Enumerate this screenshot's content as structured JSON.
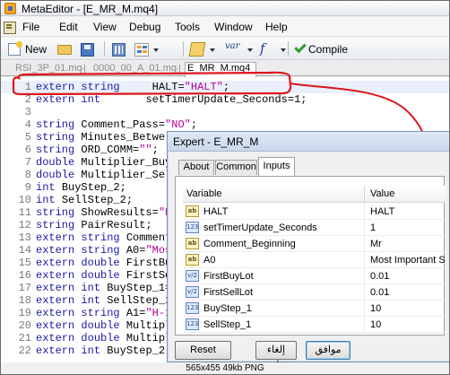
{
  "window": {
    "title": "MetaEditor - [E_MR_M.mq4]"
  },
  "menu": [
    "File",
    "Edit",
    "View",
    "Debug",
    "Tools",
    "Window",
    "Help"
  ],
  "toolbar": {
    "new_label": "New",
    "var_label": "var",
    "func_label": "f",
    "compile_label": "Compile"
  },
  "editor_tabs": [
    {
      "label": "RSI_3P_01.mq4",
      "active": false
    },
    {
      "label": "0000_00_A_01.mq4",
      "active": false
    },
    {
      "label": "E_MR_M.mq4",
      "active": true
    }
  ],
  "code_lines": [
    {
      "n": "1",
      "code": "extern string     HALT=\"HALT\";"
    },
    {
      "n": "2",
      "code": "extern int       setTimerUpdate_Seconds=1;"
    },
    {
      "n": "3",
      "code": ""
    },
    {
      "n": "4",
      "code": "string Comment_Pass=\"NO\";"
    },
    {
      "n": "5",
      "code": "string Minutes_Betwe"
    },
    {
      "n": "6",
      "code": "string ORD_COMM=\"\";"
    },
    {
      "n": "7",
      "code": "double Multiplier_Buy"
    },
    {
      "n": "8",
      "code": "double Multiplier_Sel"
    },
    {
      "n": "9",
      "code": "int BuyStep_2;"
    },
    {
      "n": "10",
      "code": "int SellStep_2;"
    },
    {
      "n": "11",
      "code": "string ShowResults=\"N"
    },
    {
      "n": "12",
      "code": "string PairResult;"
    },
    {
      "n": "13",
      "code": "extern string Comment"
    },
    {
      "n": "14",
      "code": "extern string A0=\"Mos"
    },
    {
      "n": "15",
      "code": "extern double FirstBu"
    },
    {
      "n": "16",
      "code": "extern double FirstSe"
    },
    {
      "n": "17",
      "code": "extern int BuyStep_1="
    },
    {
      "n": "18",
      "code": "extern int SellStep_1"
    },
    {
      "n": "19",
      "code": "extern string A1=\"H-1"
    },
    {
      "n": "20",
      "code": "extern double Multipl"
    },
    {
      "n": "21",
      "code": "extern double Multipl"
    },
    {
      "n": "22",
      "code": "extern int BuyStep_2"
    }
  ],
  "dialog": {
    "title": "Expert - E_MR_M",
    "tabs": [
      "About",
      "Common",
      "Inputs"
    ],
    "active_tab": "Inputs",
    "columns": [
      "Variable",
      "Value"
    ],
    "inputs": [
      {
        "type": "ab",
        "name": "HALT",
        "value": "HALT"
      },
      {
        "type": "123",
        "name": "setTimerUpdate_Seconds",
        "value": "1"
      },
      {
        "type": "ab",
        "name": "Comment_Beginning",
        "value": "Mr"
      },
      {
        "type": "ab",
        "name": "A0",
        "value": "Most Important Set"
      },
      {
        "type": "v/2",
        "name": "FirstBuyLot",
        "value": "0.01"
      },
      {
        "type": "v/2",
        "name": "FirstSellLot",
        "value": "0.01"
      },
      {
        "type": "123",
        "name": "BuyStep_1",
        "value": "10"
      },
      {
        "type": "123",
        "name": "SellStep_1",
        "value": "10"
      }
    ],
    "buttons": {
      "reset": "Reset",
      "cancel": "إلغاء الأمر",
      "ok": "موافق"
    }
  },
  "caption": "565x455  49kb  PNG",
  "colors": {
    "keyword": "#1a1aa6",
    "string": "#b8009a",
    "annotation": "#e0141c",
    "line_highlight": "#e9f0fb"
  }
}
